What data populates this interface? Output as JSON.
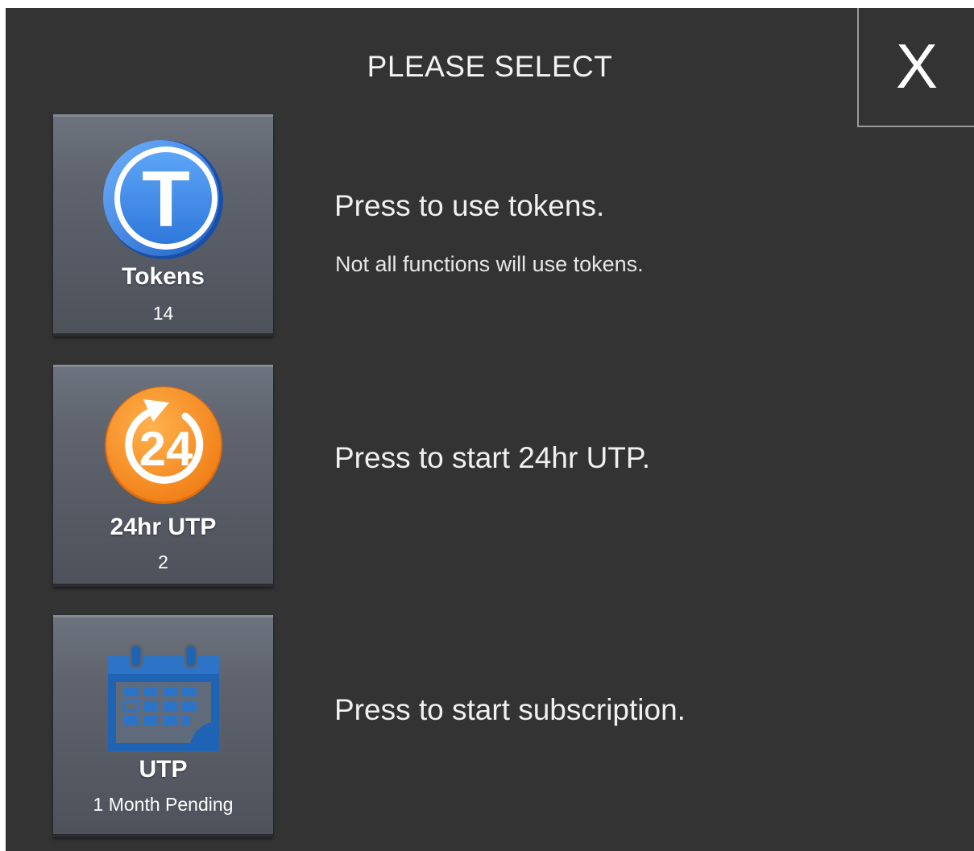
{
  "dialog": {
    "title": "PLEASE SELECT",
    "close_label": "X"
  },
  "options": [
    {
      "icon": "token-coin-icon",
      "icon_letter": "T",
      "label": "Tokens",
      "count": "14",
      "description": "Press to use tokens.",
      "note": "Not all functions will use tokens."
    },
    {
      "icon": "24hr-clock-icon",
      "icon_text": "24",
      "label": "24hr UTP",
      "count": "2",
      "description": "Press to start 24hr UTP."
    },
    {
      "icon": "calendar-icon",
      "label": "UTP",
      "count": "1 Month  Pending",
      "description": "Press to start subscription."
    }
  ],
  "colors": {
    "background": "#333333",
    "token_blue": "#3d86e6",
    "clock_orange": "#f58a1f",
    "calendar_blue": "#1e63b4"
  }
}
